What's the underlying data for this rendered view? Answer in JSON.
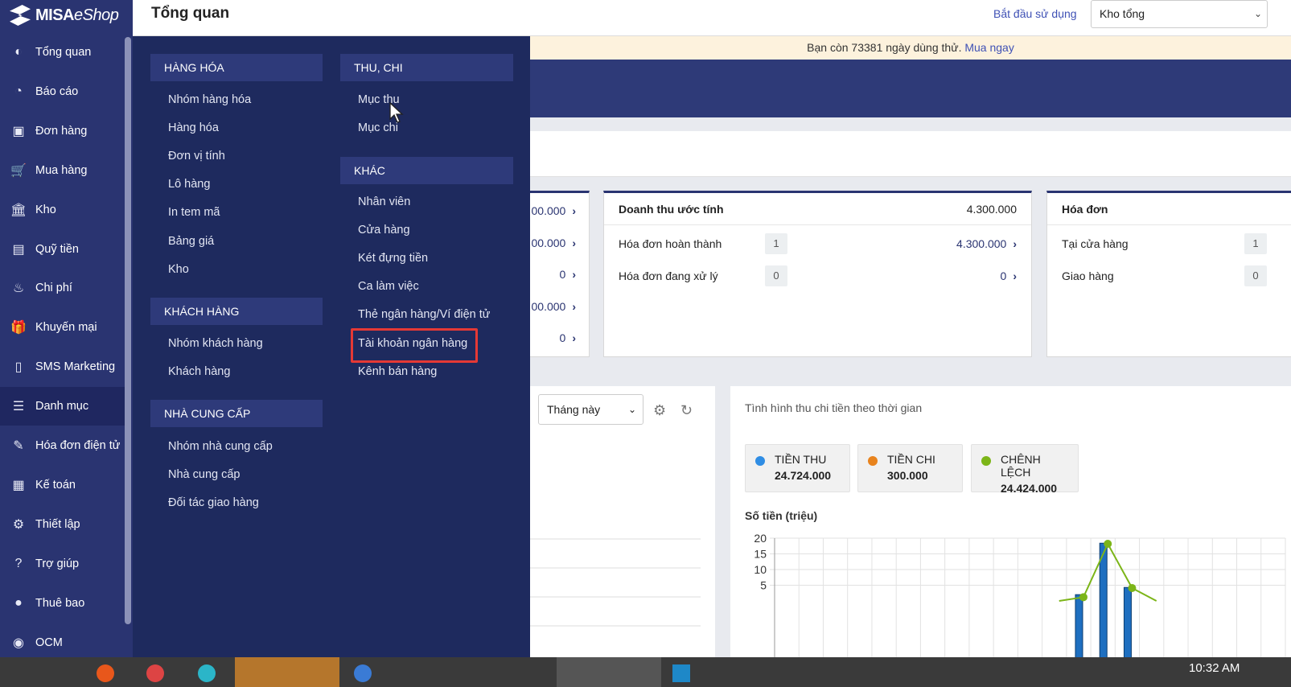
{
  "app": {
    "brand_bold": "MISA",
    "brand_light": "eShop"
  },
  "sidebar": {
    "items": [
      {
        "label": "Tổng quan",
        "icon": "dashboard-icon",
        "glyph": "◐"
      },
      {
        "label": "Báo cáo",
        "icon": "pie-chart-icon",
        "glyph": "◔"
      },
      {
        "label": "Đơn hàng",
        "icon": "order-icon",
        "glyph": "▣"
      },
      {
        "label": "Mua hàng",
        "icon": "cart-icon",
        "glyph": "🛒"
      },
      {
        "label": "Kho",
        "icon": "warehouse-icon",
        "glyph": "🏛"
      },
      {
        "label": "Quỹ tiền",
        "icon": "safe-icon",
        "glyph": "▤"
      },
      {
        "label": "Chi phí",
        "icon": "cost-icon",
        "glyph": "♨"
      },
      {
        "label": "Khuyến mại",
        "icon": "gift-icon",
        "glyph": "🎁"
      },
      {
        "label": "SMS Marketing",
        "icon": "phone-icon",
        "glyph": "▯"
      },
      {
        "label": "Danh mục",
        "icon": "list-icon",
        "glyph": "☰"
      },
      {
        "label": "Hóa đơn điện tử",
        "icon": "e-invoice-icon",
        "glyph": "✎"
      },
      {
        "label": "Kế toán",
        "icon": "calculator-icon",
        "glyph": "▦"
      },
      {
        "label": "Thiết lập",
        "icon": "gear-icon",
        "glyph": "⚙"
      },
      {
        "label": "Trợ giúp",
        "icon": "help-icon",
        "glyph": "?"
      },
      {
        "label": "Thuê bao",
        "icon": "user-icon",
        "glyph": "●"
      },
      {
        "label": "OCM",
        "icon": "ocm-icon",
        "glyph": "◉"
      }
    ]
  },
  "header": {
    "title": "Tổng quan",
    "start_link": "Bắt đầu sử dụng",
    "store": "Kho tổng"
  },
  "trial": {
    "text": "Bạn còn 73381 ngày dùng thử.",
    "link": "Mua ngay"
  },
  "menu": {
    "sections": [
      {
        "title": "HÀNG HÓA",
        "items": [
          "Nhóm hàng hóa",
          "Hàng hóa",
          "Đơn vị tính",
          "Lô hàng",
          "In tem mã",
          "Bảng giá",
          "Kho"
        ]
      },
      {
        "title": "KHÁCH HÀNG",
        "items": [
          "Nhóm khách hàng",
          "Khách hàng"
        ]
      },
      {
        "title": "NHÀ CUNG CẤP",
        "items": [
          "Nhóm nhà cung cấp",
          "Nhà cung cấp",
          "Đối tác giao hàng"
        ]
      },
      {
        "title": "THU, CHI",
        "items": [
          "Mục thu",
          "Mục chi"
        ]
      },
      {
        "title": "KHÁC",
        "items": [
          "Nhân viên",
          "Cửa hàng",
          "Két đựng tiền",
          "Ca làm việc",
          "Thẻ ngân hàng/Ví điện tử",
          "Tài khoản ngân hàng",
          "Kênh bán hàng"
        ]
      }
    ]
  },
  "card_left": {
    "values": [
      "00.000",
      "00.000",
      "0",
      "00.000",
      "0"
    ]
  },
  "card_revenue": {
    "title": "Doanh thu ước tính",
    "total": "4.300.000",
    "rows": [
      {
        "label": "Hóa đơn hoàn thành",
        "count": "1",
        "amount": "4.300.000"
      },
      {
        "label": "Hóa đơn đang xử lý",
        "count": "0",
        "amount": "0"
      }
    ]
  },
  "card_invoice": {
    "title": "Hóa đơn",
    "rows": [
      {
        "label": "Tại cửa hàng",
        "count": "1"
      },
      {
        "label": "Giao hàng",
        "count": "0"
      }
    ]
  },
  "period": {
    "value": "Tháng này"
  },
  "chart_panel": {
    "title": "Tình hình thu chi tiền theo thời gian",
    "legend": [
      {
        "name": "TIỀN THU",
        "value": "24.724.000",
        "color": "#2f8de4"
      },
      {
        "name": "TIỀN CHI",
        "value": "300.000",
        "color": "#e8831d"
      },
      {
        "name": "CHÊNH LỆCH",
        "value": "24.424.000",
        "color": "#7cb518"
      }
    ],
    "ylabel": "Số tiền (triệu)"
  },
  "chart_data": {
    "type": "bar",
    "ylabel": "Số tiền (triệu)",
    "ylim": [
      0,
      20
    ],
    "yticks": [
      "20",
      "15",
      "10",
      "5"
    ],
    "series": [
      {
        "name": "TIỀN THU",
        "values": [
          0,
          0,
          0,
          0,
          0,
          0,
          0,
          0,
          0,
          0,
          0,
          0,
          2,
          18.4,
          4.3,
          0,
          0,
          0,
          0,
          0,
          0
        ]
      },
      {
        "name": "CHÊNH LỆCH",
        "values": [
          0,
          0,
          0,
          0,
          0,
          0,
          0,
          0,
          0,
          0,
          0,
          0,
          1.2,
          18.2,
          4.1,
          0,
          0,
          0,
          0,
          0,
          0
        ]
      }
    ],
    "grid": true
  },
  "clock": {
    "time": "10:32 AM"
  }
}
